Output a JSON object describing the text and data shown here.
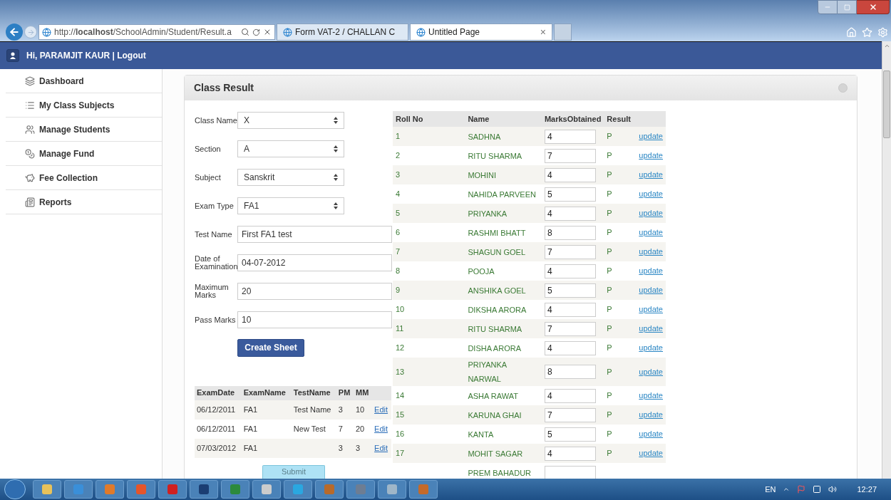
{
  "browser": {
    "address": "http://**localhost**/SchoolAdmin/Student/Result.a",
    "tabs": [
      {
        "title": "Form VAT-2 / CHALLAN C",
        "selected": false
      },
      {
        "title": "Untitled Page",
        "selected": true,
        "close": "×"
      }
    ]
  },
  "header": {
    "greeting": "Hi, PARAMJIT KAUR | Logout"
  },
  "sidebar": {
    "items": [
      {
        "label": "Dashboard",
        "kind": "dashboard"
      },
      {
        "label": "My Class Subjects",
        "kind": "subjects"
      },
      {
        "label": "Manage Students",
        "kind": "students"
      },
      {
        "label": "Manage Fund",
        "kind": "fund"
      },
      {
        "label": "Fee Collection",
        "kind": "fee"
      },
      {
        "label": "Reports",
        "kind": "reports"
      }
    ]
  },
  "panel": {
    "title": "Class Result",
    "form": {
      "fields": [
        {
          "kind": "select",
          "label": "Class Name",
          "value": "X"
        },
        {
          "kind": "select",
          "label": "Section",
          "value": "A"
        },
        {
          "kind": "select",
          "label": "Subject",
          "value": "Sanskrit"
        },
        {
          "kind": "select",
          "label": "Exam Type",
          "value": "FA1"
        },
        {
          "kind": "text",
          "label": "Test Name",
          "value": "First FA1 test"
        },
        {
          "kind": "text",
          "label": "Date of Examination",
          "value": "04-07-2012"
        },
        {
          "kind": "text",
          "label": "Maximum Marks",
          "value": "20"
        },
        {
          "kind": "text",
          "label": "Pass Marks",
          "value": "10"
        }
      ],
      "button": "Create Sheet"
    },
    "history": {
      "columns": [
        "ExamDate",
        "ExamName",
        "TestName",
        "PM",
        "MM"
      ],
      "rows": [
        {
          "cells": [
            "06/12/2011",
            "FA1",
            "Test Name",
            "3",
            "10"
          ],
          "action": "Edit"
        },
        {
          "cells": [
            "06/12/2011",
            "FA1",
            "New Test",
            "7",
            "20"
          ],
          "action": "Edit"
        },
        {
          "cells": [
            "07/03/2012",
            "FA1",
            "",
            "3",
            "3"
          ],
          "action": "Edit"
        }
      ]
    },
    "submit": "Submit",
    "results": {
      "columns": [
        "Roll No",
        "Name",
        "MarksObtained",
        "Result"
      ],
      "rows": [
        {
          "roll_no": "1",
          "name": "SADHNA",
          "marks": "4",
          "result": "P",
          "action": "update"
        },
        {
          "roll_no": "2",
          "name": "RITU SHARMA",
          "marks": "7",
          "result": "P",
          "action": "update"
        },
        {
          "roll_no": "3",
          "name": "MOHINI",
          "marks": "4",
          "result": "P",
          "action": "update"
        },
        {
          "roll_no": "4",
          "name": "NAHIDA PARVEEN",
          "marks": "5",
          "result": "P",
          "action": "update"
        },
        {
          "roll_no": "5",
          "name": "PRIYANKA",
          "marks": "4",
          "result": "P",
          "action": "update"
        },
        {
          "roll_no": "6",
          "name": "RASHMI BHATT",
          "marks": "8",
          "result": "P",
          "action": "update"
        },
        {
          "roll_no": "7",
          "name": "SHAGUN GOEL",
          "marks": "7",
          "result": "P",
          "action": "update"
        },
        {
          "roll_no": "8",
          "name": "POOJA",
          "marks": "4",
          "result": "P",
          "action": "update"
        },
        {
          "roll_no": "9",
          "name": "ANSHIKA GOEL",
          "marks": "5",
          "result": "P",
          "action": "update"
        },
        {
          "roll_no": "10",
          "name": "DIKSHA ARORA",
          "marks": "4",
          "result": "P",
          "action": "update"
        },
        {
          "roll_no": "11",
          "name": "RITU SHARMA",
          "marks": "7",
          "result": "P",
          "action": "update"
        },
        {
          "roll_no": "12",
          "name": "DISHA ARORA",
          "marks": "4",
          "result": "P",
          "action": "update"
        },
        {
          "roll_no": "13",
          "name": "PRIYANKA NARWAL",
          "marks": "8",
          "result": "P",
          "action": "update"
        },
        {
          "roll_no": "14",
          "name": "ASHA RAWAT",
          "marks": "4",
          "result": "P",
          "action": "update"
        },
        {
          "roll_no": "15",
          "name": "KARUNA GHAI",
          "marks": "7",
          "result": "P",
          "action": "update"
        },
        {
          "roll_no": "16",
          "name": "KANTA",
          "marks": "5",
          "result": "P",
          "action": "update"
        },
        {
          "roll_no": "17",
          "name": "MOHIT SAGAR",
          "marks": "4",
          "result": "P",
          "action": "update"
        },
        {
          "name": "PREM BAHADUR"
        }
      ]
    }
  },
  "taskbar": {
    "language": "EN",
    "time": "12:27"
  }
}
